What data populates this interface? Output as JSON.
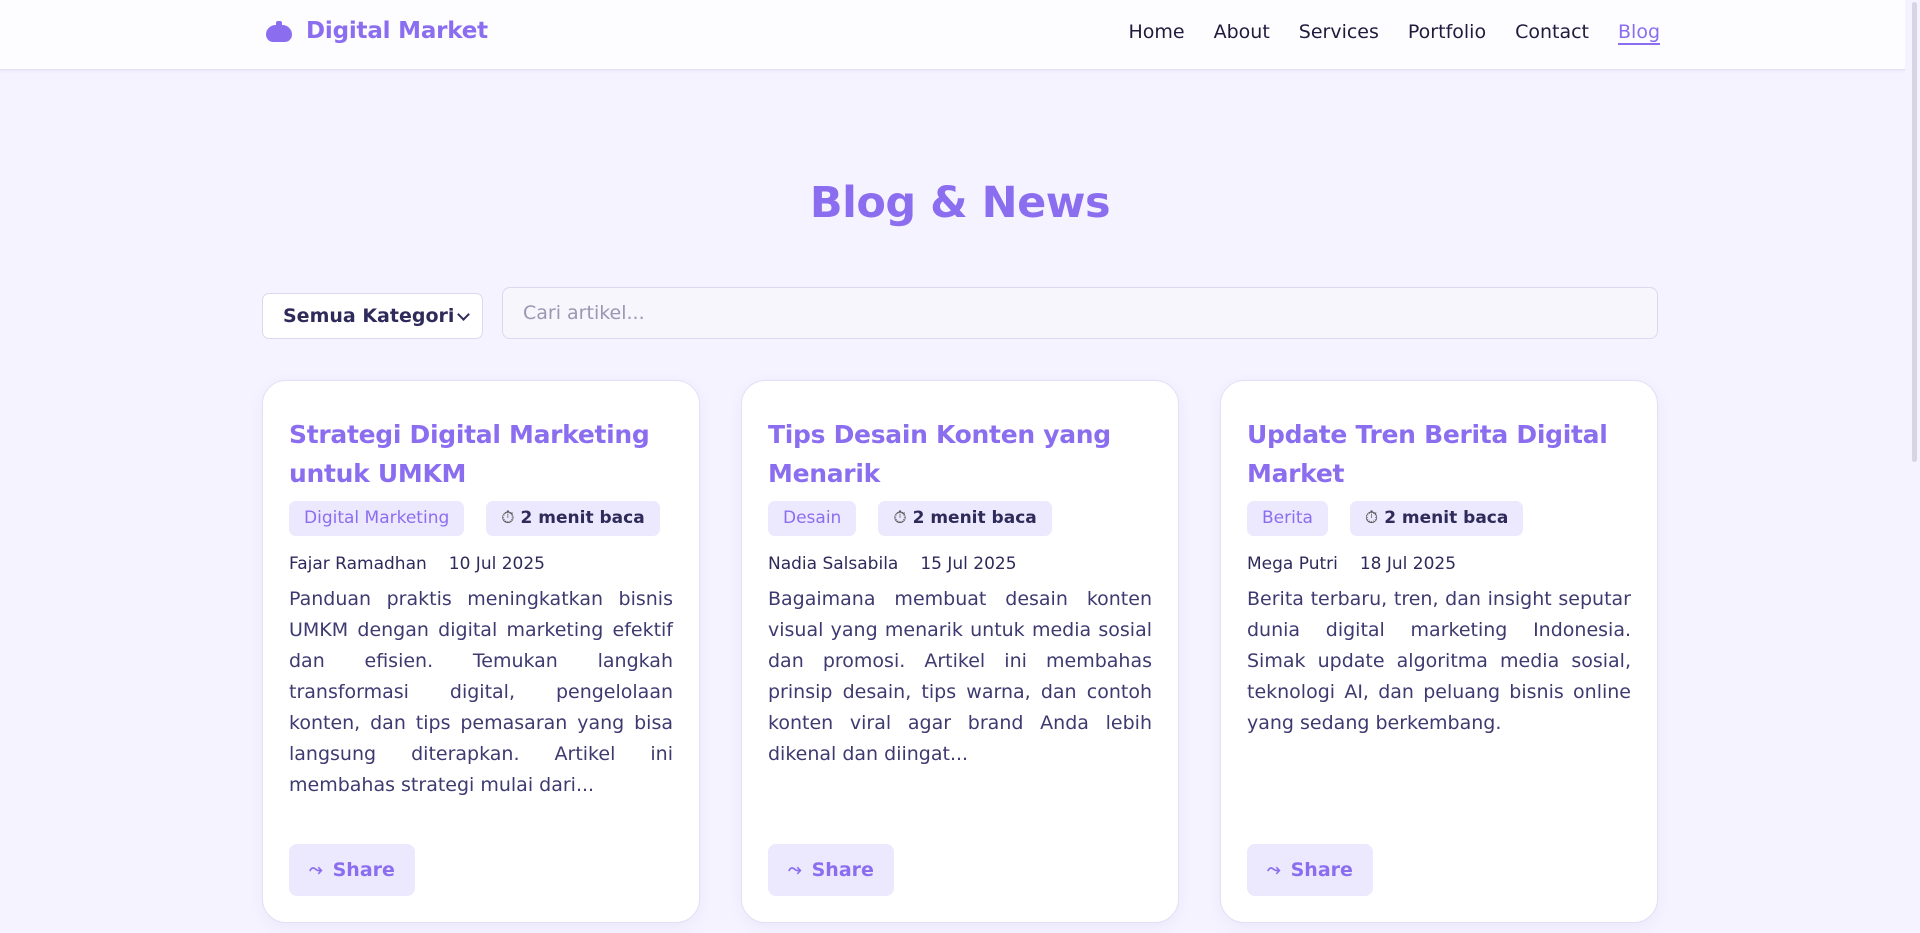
{
  "header": {
    "brand_name": "Digital Market",
    "brand_icon": "hat-icon",
    "nav": [
      {
        "label": "Home",
        "active": false
      },
      {
        "label": "About",
        "active": false
      },
      {
        "label": "Services",
        "active": false
      },
      {
        "label": "Portfolio",
        "active": false
      },
      {
        "label": "Contact",
        "active": false
      },
      {
        "label": "Blog",
        "active": true
      }
    ]
  },
  "page": {
    "title": "Blog & News"
  },
  "filters": {
    "category_selected": "Semua Kategori",
    "search_placeholder": "Cari artikel...",
    "search_value": ""
  },
  "articles": [
    {
      "title": "Strategi Digital Marketing untuk UMKM",
      "category": "Digital Marketing",
      "read_time": "2 menit baca",
      "author": "Fajar Ramadhan",
      "date": "10 Jul 2025",
      "excerpt": "Panduan praktis meningkatkan bisnis UMKM dengan digital marketing efektif dan efisien. Temukan langkah transformasi digital, pengelolaan konten, dan tips pemasaran yang bisa langsung diterapkan. Artikel ini membahas strategi mulai dari...",
      "share_label": "Share"
    },
    {
      "title": "Tips Desain Konten yang Menarik",
      "category": "Desain",
      "read_time": "2 menit baca",
      "author": "Nadia Salsabila",
      "date": "15 Jul 2025",
      "excerpt": "Bagaimana membuat desain konten visual yang menarik untuk media sosial dan promosi. Artikel ini membahas prinsip desain, tips warna, dan contoh konten viral agar brand Anda lebih dikenal dan diingat...",
      "share_label": "Share"
    },
    {
      "title": "Update Tren Berita Digital Market",
      "category": "Berita",
      "read_time": "2 menit baca",
      "author": "Mega Putri",
      "date": "18 Jul 2025",
      "excerpt": "Berita terbaru, tren, dan insight seputar dunia digital marketing Indonesia. Simak update algoritma media sosial, teknologi AI, dan peluang bisnis online yang sedang berkembang.",
      "share_label": "Share"
    }
  ],
  "icons": {
    "timer": "⏱",
    "share": "⤳"
  },
  "colors": {
    "accent": "#8b6ef0",
    "background": "#f5f3ff",
    "tag_background": "#ece8fd",
    "text": "#2e2a5a"
  }
}
